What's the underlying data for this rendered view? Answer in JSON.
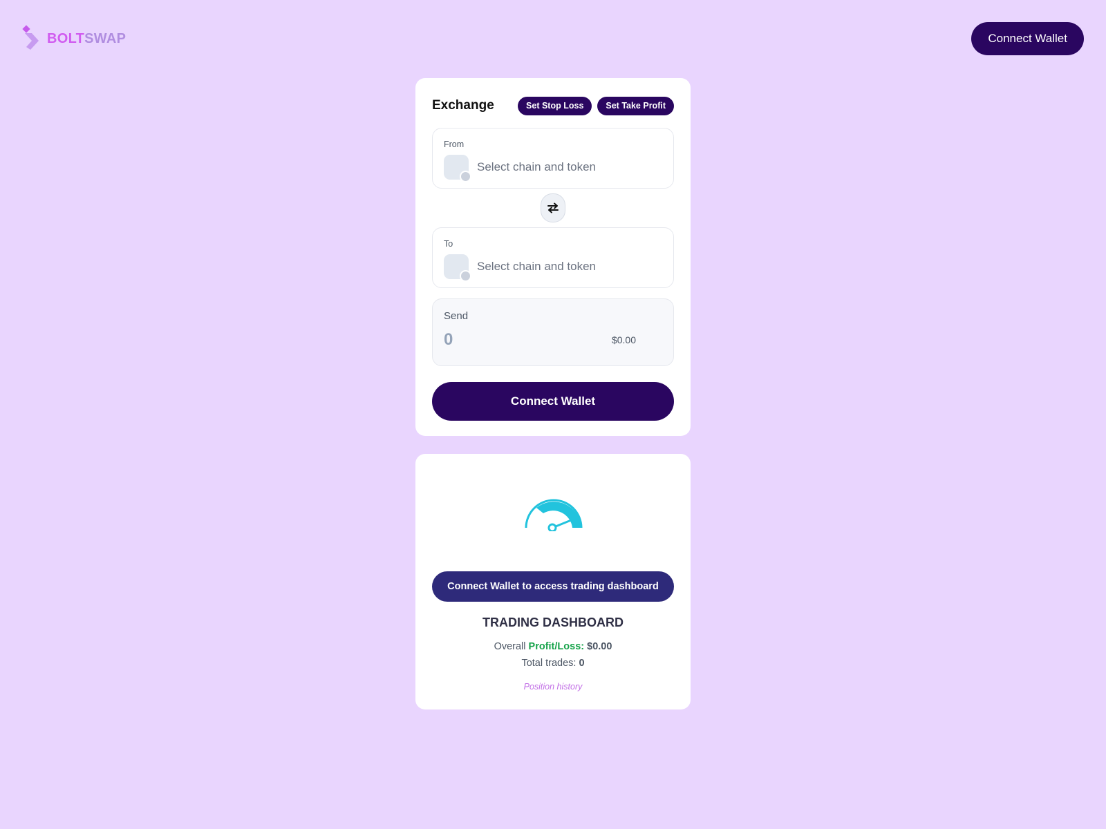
{
  "brand": {
    "name_part1": "BOLT",
    "name_part2": "SWAP"
  },
  "header": {
    "connect_label": "Connect Wallet"
  },
  "exchange": {
    "title": "Exchange",
    "stop_loss_label": "Set Stop Loss",
    "take_profit_label": "Set Take Profit",
    "from": {
      "label": "From",
      "placeholder": "Select chain and token"
    },
    "to": {
      "label": "To",
      "placeholder": "Select chain and token"
    },
    "send": {
      "label": "Send",
      "amount_placeholder": "0",
      "usd_value": "$0.00"
    },
    "connect_label": "Connect Wallet"
  },
  "dashboard": {
    "connect_label": "Connect Wallet to access trading dashboard",
    "title": "TRADING DASHBOARD",
    "overall_prefix": "Overall",
    "pl_label": "Profit/Loss:",
    "pl_value": "$0.00",
    "trades_label": "Total trades:",
    "trades_value": "0",
    "history_link": "Position history"
  },
  "colors": {
    "background": "#e9d5fe",
    "primary_button": "#2a0660",
    "dashboard_button": "#2e2a7a",
    "gauge": "#22c3dd",
    "profit": "#16a34a",
    "brand_bolt": "#d15cf0",
    "brand_swap": "#b08de0"
  }
}
